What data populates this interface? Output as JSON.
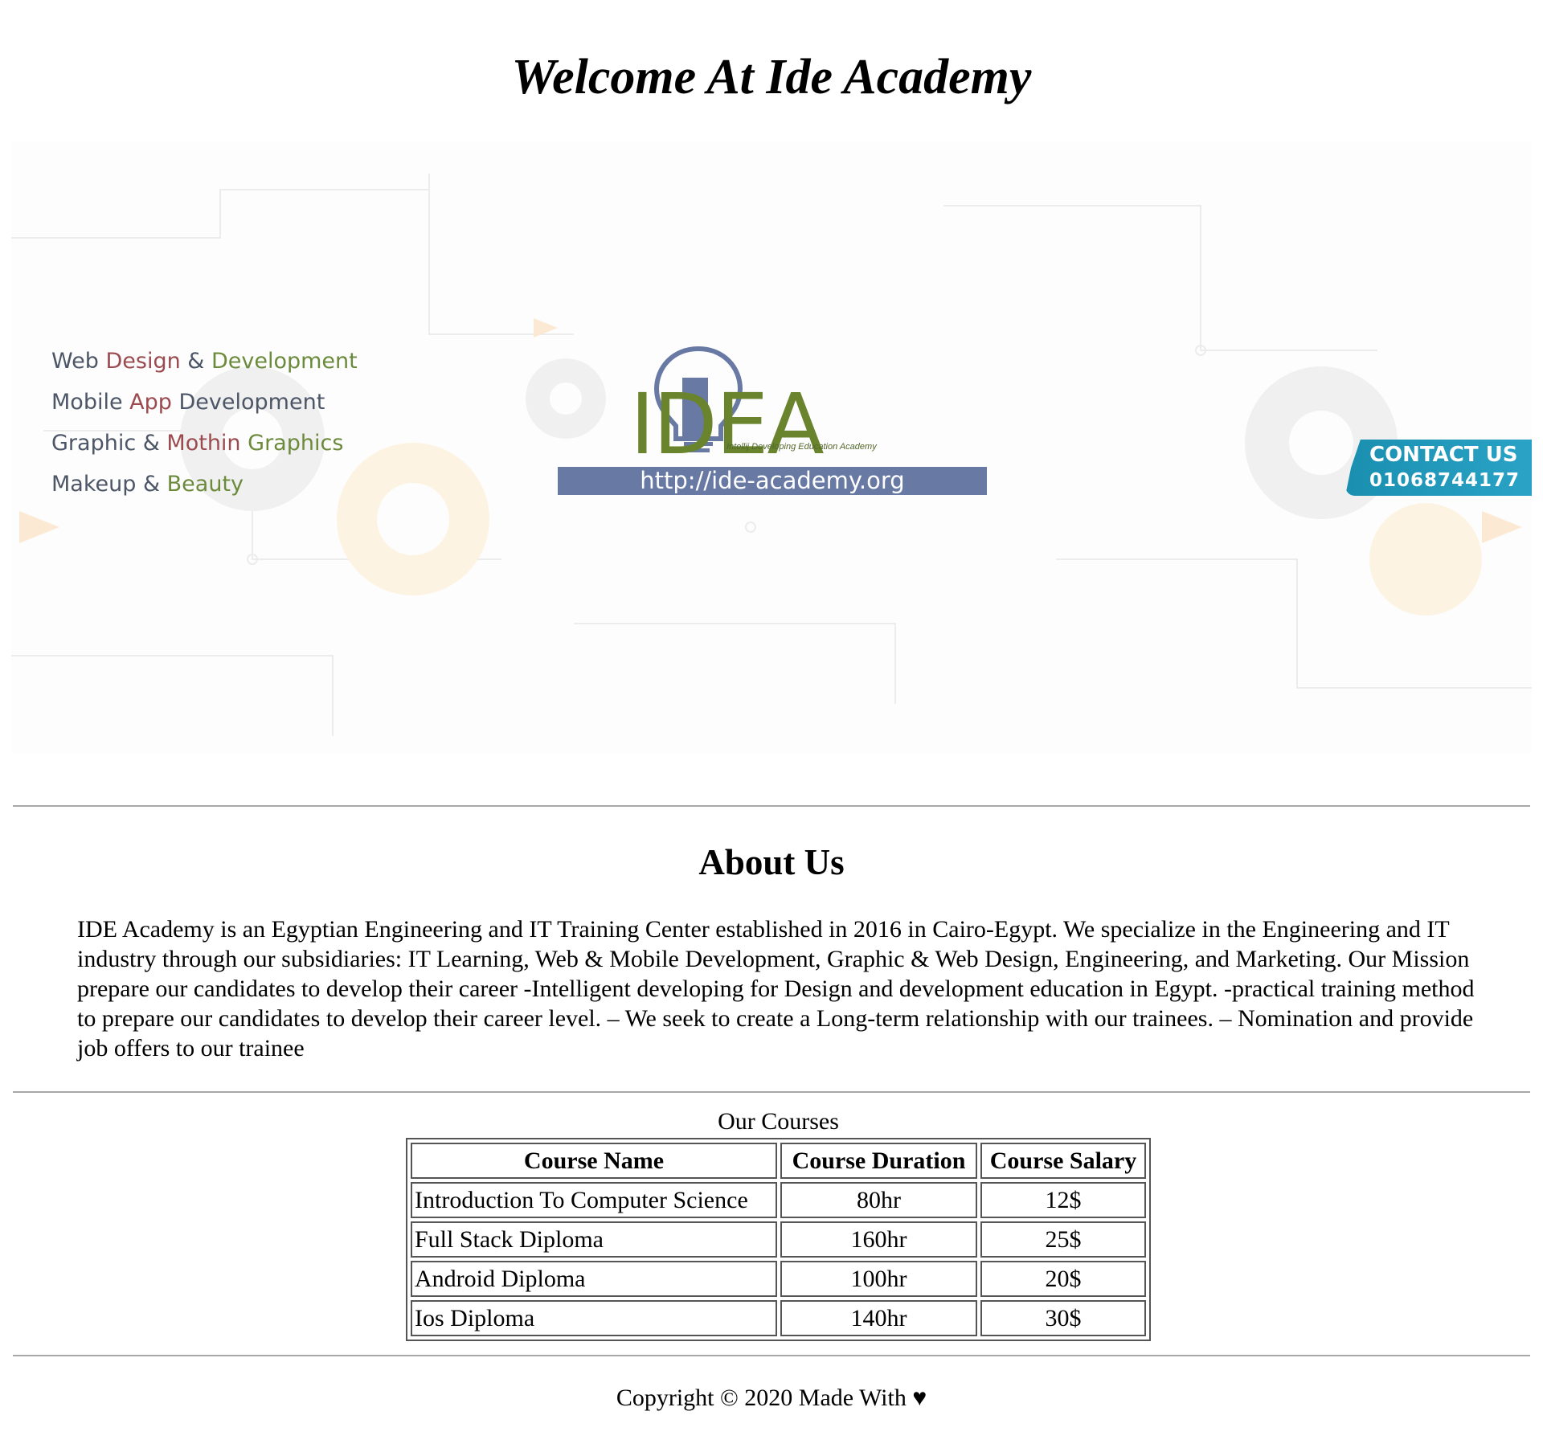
{
  "header": {
    "title": "Welcome At Ide Academy"
  },
  "banner": {
    "services": [
      {
        "parts": [
          "Web",
          "Design",
          "&",
          "Development"
        ]
      },
      {
        "parts": [
          "Mobile",
          "App",
          "Development"
        ]
      },
      {
        "parts": [
          "Graphic",
          "&",
          "Mothin",
          "Graphics"
        ]
      },
      {
        "parts": [
          "Makeup",
          "&",
          "Beauty"
        ]
      }
    ],
    "logo": {
      "wordmark": "IDEA",
      "tagline": "Intellij Developing Education Academy",
      "url": "http://ide-academy.org"
    },
    "contact": {
      "label": "CONTACT US",
      "phone": "01068744177"
    },
    "colors": {
      "slate": "#4c5667",
      "red": "#9b4a4f",
      "green": "#6b8a3c",
      "url_bar": "#6879a4",
      "badge": "#1a8fb0"
    }
  },
  "about": {
    "heading": "About Us",
    "text": "IDE Academy is an Egyptian Engineering and IT Training Center established in 2016 in Cairo-Egypt. We specialize in the Engineering and IT industry through our subsidiaries: IT Learning, Web & Mobile Development, Graphic & Web Design, Engineering, and Marketing. Our Mission prepare our candidates to develop their career -Intelligent developing for Design and development education in Egypt. -practical training method to prepare our candidates to develop their career level. – We seek to create a Long-term relationship with our trainees. – Nomination and provide job offers to our trainee"
  },
  "courses": {
    "caption": "Our Courses",
    "headers": [
      "Course Name",
      "Course Duration",
      "Course Salary"
    ],
    "rows": [
      [
        "Introduction To Computer Science",
        "80hr",
        "12$"
      ],
      [
        "Full Stack Diploma",
        "160hr",
        "25$"
      ],
      [
        "Android Diploma",
        "100hr",
        "20$"
      ],
      [
        "Ios Diploma",
        "140hr",
        "30$"
      ]
    ]
  },
  "footer": {
    "text": "Copyright © 2020 Made With ♥"
  }
}
